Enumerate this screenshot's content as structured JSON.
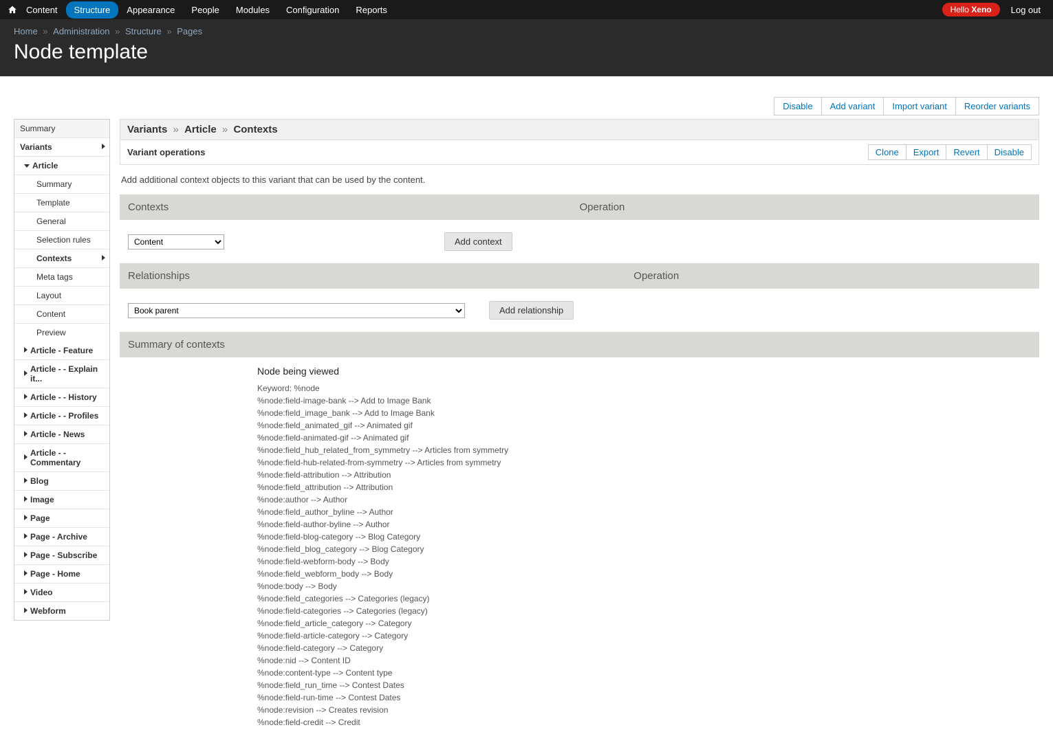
{
  "toolbar": {
    "items": [
      "Content",
      "Structure",
      "Appearance",
      "People",
      "Modules",
      "Configuration",
      "Reports"
    ],
    "active_index": 1,
    "hello_prefix": "Hello ",
    "username": "Xeno",
    "logout": "Log out"
  },
  "breadcrumb": [
    "Home",
    "Administration",
    "Structure",
    "Pages"
  ],
  "page_title": "Node template",
  "page_tabs": [
    "Disable",
    "Add variant",
    "Import variant",
    "Reorder variants"
  ],
  "sidebar": {
    "summary": "Summary",
    "variants": "Variants",
    "article": "Article",
    "article_children": [
      "Summary",
      "Template",
      "General",
      "Selection rules",
      "Contexts",
      "Meta tags",
      "Layout",
      "Content",
      "Preview"
    ],
    "article_active_index": 4,
    "other_variants": [
      "Article - Feature",
      "Article - - Explain it...",
      "Article - - History",
      "Article - - Profiles",
      "Article - News",
      "Article - - Commentary",
      "Blog",
      "Image",
      "Page",
      "Page - Archive",
      "Page - Subscribe",
      "Page - Home",
      "Video",
      "Webform"
    ]
  },
  "content": {
    "path": [
      "Variants",
      "Article",
      "Contexts"
    ],
    "variant_ops_label": "Variant operations",
    "variant_ops": [
      "Clone",
      "Export",
      "Revert",
      "Disable"
    ],
    "description": "Add additional context objects to this variant that can be used by the content.",
    "contexts": {
      "header_left": "Contexts",
      "header_right": "Operation",
      "select_value": "Content",
      "button": "Add context"
    },
    "relationships": {
      "header_left": "Relationships",
      "header_right": "Operation",
      "select_value": "Book parent",
      "button": "Add relationship"
    },
    "summary": {
      "header": "Summary of contexts",
      "node_title": "Node being viewed",
      "lines": [
        "Keyword: %node",
        "%node:field-image-bank --> Add to Image Bank",
        "%node:field_image_bank --> Add to Image Bank",
        "%node:field_animated_gif --> Animated gif",
        "%node:field-animated-gif --> Animated gif",
        "%node:field_hub_related_from_symmetry --> Articles from symmetry",
        "%node:field-hub-related-from-symmetry --> Articles from symmetry",
        "%node:field-attribution --> Attribution",
        "%node:field_attribution --> Attribution",
        "%node:author --> Author",
        "%node:field_author_byline --> Author",
        "%node:field-author-byline --> Author",
        "%node:field-blog-category --> Blog Category",
        "%node:field_blog_category --> Blog Category",
        "%node:field-webform-body --> Body",
        "%node:field_webform_body --> Body",
        "%node:body --> Body",
        "%node:field_categories --> Categories (legacy)",
        "%node:field-categories --> Categories (legacy)",
        "%node:field_article_category --> Category",
        "%node:field-article-category --> Category",
        "%node:field-category --> Category",
        "%node:nid --> Content ID",
        "%node:content-type --> Content type",
        "%node:field_run_time --> Contest Dates",
        "%node:field-run-time --> Contest Dates",
        "%node:revision --> Creates revision",
        "%node:field-credit --> Credit"
      ]
    }
  }
}
